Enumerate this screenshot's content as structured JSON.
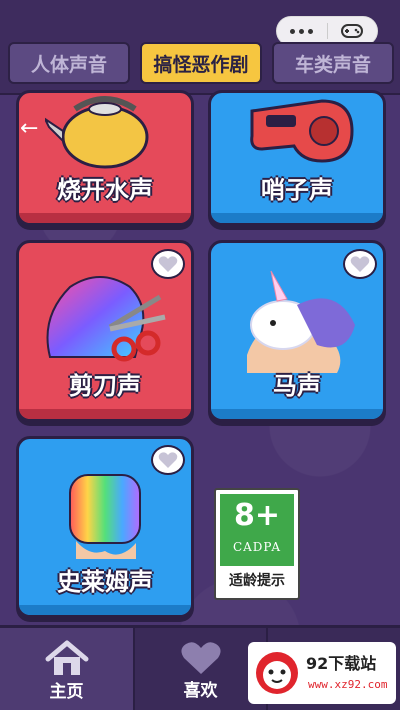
{
  "tabs": [
    {
      "label": "人体声音"
    },
    {
      "label": "搞怪恶作剧"
    },
    {
      "label": "车类声音"
    }
  ],
  "cards": [
    {
      "label": "烧开水声",
      "color": "#e54a5a",
      "icon": "kettle-icon"
    },
    {
      "label": "哨子声",
      "color": "#2e9ef0",
      "icon": "whistle-icon"
    },
    {
      "label": "剪刀声",
      "color": "#e54a5a",
      "icon": "scissors-ball-icon"
    },
    {
      "label": "马声",
      "color": "#2e9ef0",
      "icon": "unicorn-squishy-icon"
    },
    {
      "label": "史莱姆声",
      "color": "#2e9ef0",
      "icon": "slime-icon"
    }
  ],
  "age_rating": {
    "number": "8+",
    "org": "CADPA",
    "tip": "适龄提示"
  },
  "nav": [
    {
      "label": "主页",
      "icon": "home-icon"
    },
    {
      "label": "喜欢",
      "icon": "heart-icon"
    },
    {
      "label": "",
      "icon": "house-icon"
    }
  ],
  "watermark": {
    "title": "92下载站",
    "url": "www.xz92.com"
  },
  "colors": {
    "background": "#4a3570",
    "active_tab": "#f6c640",
    "red_card": "#e54a5a",
    "blue_card": "#2e9ef0",
    "cadpa_green": "#3fa84a"
  }
}
